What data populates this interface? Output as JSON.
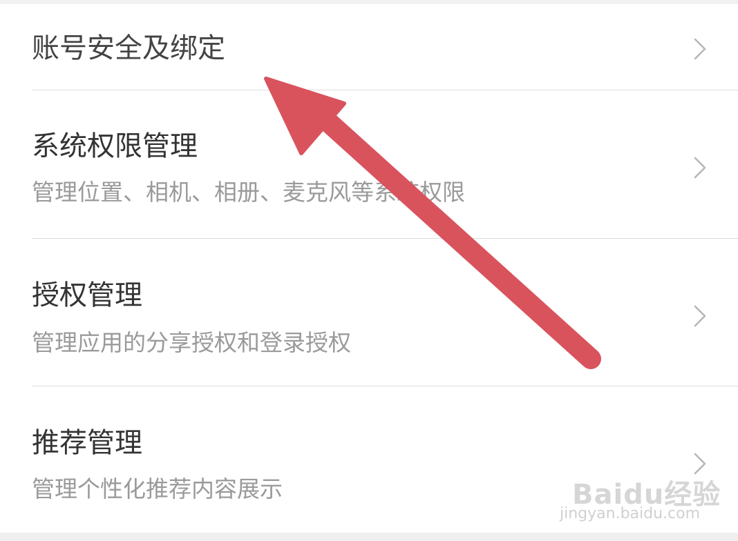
{
  "settings": {
    "items": [
      {
        "title": "账号安全及绑定",
        "subtitle": ""
      },
      {
        "title": "系统权限管理",
        "subtitle": "管理位置、相机、相册、麦克风等系统权限"
      },
      {
        "title": "授权管理",
        "subtitle": "管理应用的分享授权和登录授权"
      },
      {
        "title": "推荐管理",
        "subtitle": "管理个性化推荐内容展示"
      }
    ]
  },
  "icons": {
    "chevron": "chevron-right-icon",
    "annotation": "red-arrow-icon"
  },
  "watermark": {
    "logo": "Baidu经验",
    "url": "jingyan.baidu.com"
  },
  "colors": {
    "arrow": "#d9535d",
    "title": "#333333",
    "subtitle": "#9a9a9a",
    "divider": "#dcdcdc",
    "background": "#ffffff"
  }
}
